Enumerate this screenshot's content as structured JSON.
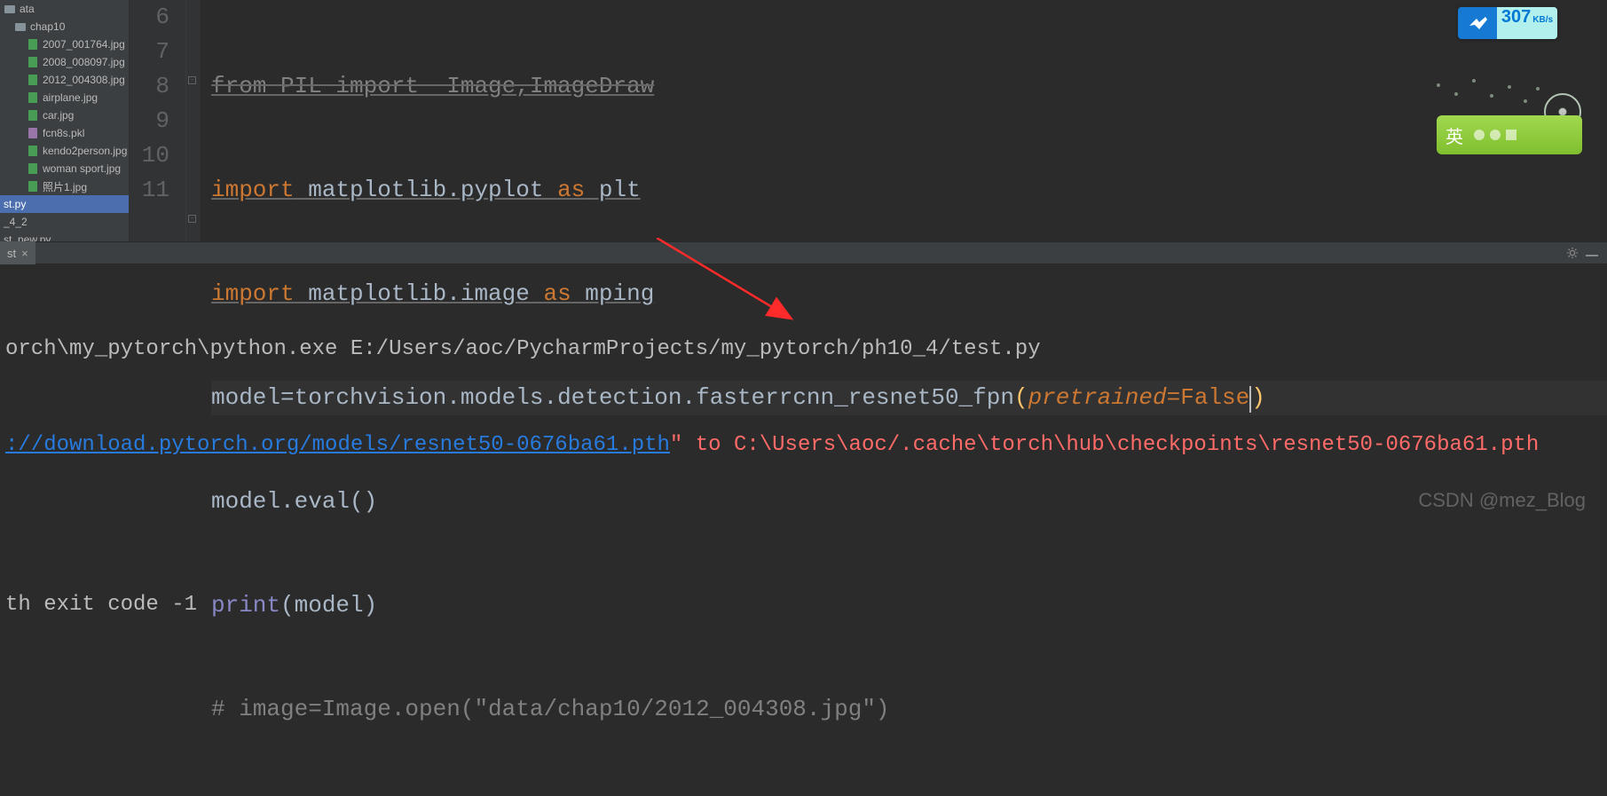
{
  "sidebar": {
    "items": [
      {
        "label": "ata",
        "kind": "folder",
        "lvl": 1
      },
      {
        "label": "chap10",
        "kind": "folder",
        "lvl": 2
      },
      {
        "label": "2007_001764.jpg",
        "kind": "img",
        "lvl": 3
      },
      {
        "label": "2008_008097.jpg",
        "kind": "img",
        "lvl": 3
      },
      {
        "label": "2012_004308.jpg",
        "kind": "img",
        "lvl": 3
      },
      {
        "label": "airplane.jpg",
        "kind": "img",
        "lvl": 3
      },
      {
        "label": "car.jpg",
        "kind": "img",
        "lvl": 3
      },
      {
        "label": "fcn8s.pkl",
        "kind": "pkl",
        "lvl": 3
      },
      {
        "label": "kendo2person.jpg",
        "kind": "img",
        "lvl": 3
      },
      {
        "label": "woman sport.jpg",
        "kind": "img",
        "lvl": 3
      },
      {
        "label": "照片1.jpg",
        "kind": "img",
        "lvl": 3
      },
      {
        "label": "st.py",
        "kind": "py",
        "lvl": 1,
        "selected": true
      },
      {
        "label": "_4_2",
        "kind": "folder",
        "lvl": 1
      },
      {
        "label": "st_new.py",
        "kind": "py",
        "lvl": 1
      }
    ]
  },
  "gutter": [
    "",
    "6",
    "7",
    "8",
    "9",
    "10",
    "11"
  ],
  "code": {
    "l5": {
      "text": "from PIL import  Image,ImageDraw"
    },
    "l6": {
      "kw": "import",
      "pkg": " matplotlib.pyplot ",
      "as": "as",
      "alias": " plt"
    },
    "l7": {
      "kw": "import",
      "pkg": " matplotlib.image ",
      "as": "as",
      "alias": " mping"
    },
    "l8": {
      "a": "model",
      "eq": "=",
      "b": "torchvision.models.detection.fasterrcnn_resnet50_fpn",
      "lp": "(",
      "arg": "pretrained",
      "eq2": "=",
      "val": "False",
      "rp": ")"
    },
    "l9": {
      "a": "model.eval",
      "lp": "(",
      "rp": ")"
    },
    "l10": {
      "fn": "print",
      "lp": "(",
      "arg": "model",
      "rp": ")"
    },
    "l11": {
      "c": "# image=Image.open(\"data/chap10/2012_004308.jpg\")"
    }
  },
  "run_tab": {
    "label": "st",
    "close": "×"
  },
  "console": {
    "l1": "orch\\my_pytorch\\python.exe E:/Users/aoc/PycharmProjects/my_pytorch/ph10_4/test.py",
    "l2_link": "://download.pytorch.org/models/resnet50-0676ba61.pth",
    "l2_q": "\"",
    "l2_red": " to C:\\Users\\aoc/.cache\\torch\\hub\\checkpoints\\resnet50-0676ba61.pth",
    "blank": "",
    "l4": "th exit code -1"
  },
  "speed": {
    "value": "307",
    "unit": "KB/s"
  },
  "ime": {
    "lang": "英"
  },
  "watermark": "CSDN @mez_Blog"
}
